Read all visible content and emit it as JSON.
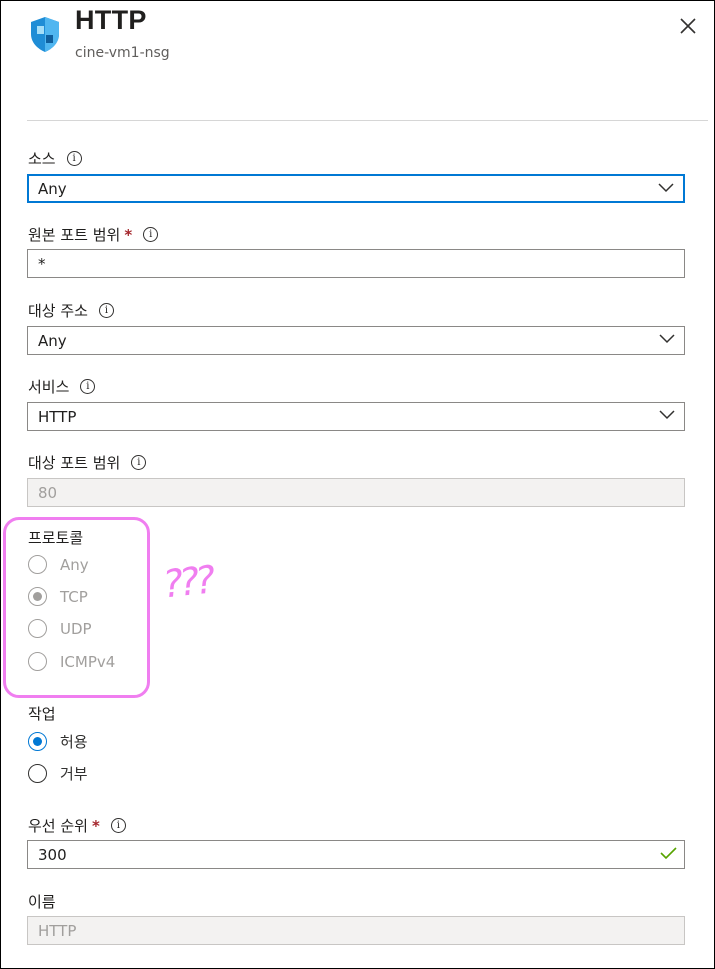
{
  "header": {
    "title": "HTTP",
    "subtitle": "cine-vm1-nsg"
  },
  "fields": {
    "source": {
      "label": "소스",
      "value": "Any"
    },
    "source_port": {
      "label": "원본 포트 범위",
      "required": "*",
      "value": "*"
    },
    "destination": {
      "label": "대상 주소",
      "value": "Any"
    },
    "service": {
      "label": "서비스",
      "value": "HTTP"
    },
    "dest_port": {
      "label": "대상 포트 범위",
      "value": "80"
    },
    "protocol": {
      "label": "프로토콜",
      "options": [
        "Any",
        "TCP",
        "UDP",
        "ICMPv4"
      ],
      "selected": "TCP"
    },
    "action": {
      "label": "작업",
      "options": [
        "허용",
        "거부"
      ],
      "selected": "허용"
    },
    "priority": {
      "label": "우선 순위",
      "required": "*",
      "value": "300"
    },
    "name": {
      "label": "이름",
      "value": "HTTP"
    }
  },
  "annotation": {
    "text": "???"
  },
  "colors": {
    "accent": "#0078d4",
    "annotation": "#f07ef0",
    "required": "#a4262c",
    "valid_check": "#57a300"
  }
}
